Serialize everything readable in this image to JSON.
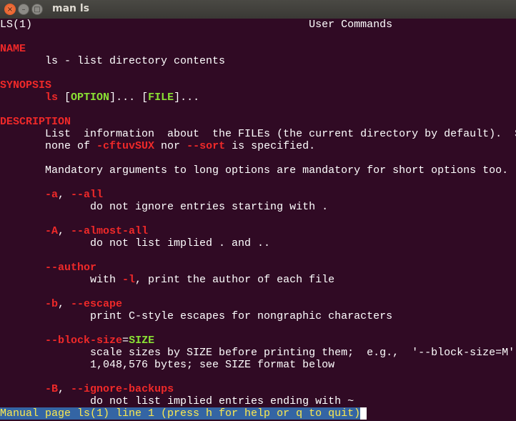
{
  "window": {
    "title": "man ls",
    "buttons": {
      "close": "×",
      "minimize": "–",
      "maximize": "□"
    }
  },
  "colors": {
    "background": "#300a24",
    "heading": "#ef2929",
    "argument": "#8ae234",
    "status_bg": "#3465a4",
    "status_fg": "#fce94f"
  },
  "lines": [
    [
      {
        "t": "LS(1)                                           User Commands",
        "c": "n"
      }
    ],
    [],
    [
      {
        "t": "NAME",
        "c": "r"
      }
    ],
    [
      {
        "t": "       ls - list directory contents",
        "c": "n"
      }
    ],
    [],
    [
      {
        "t": "SYNOPSIS",
        "c": "r"
      }
    ],
    [
      {
        "t": "       ",
        "c": "n"
      },
      {
        "t": "ls",
        "c": "r"
      },
      {
        "t": " [",
        "c": "n"
      },
      {
        "t": "OPTION",
        "c": "g"
      },
      {
        "t": "]... [",
        "c": "n"
      },
      {
        "t": "FILE",
        "c": "g"
      },
      {
        "t": "]...",
        "c": "n"
      }
    ],
    [],
    [
      {
        "t": "DESCRIPTION",
        "c": "r"
      }
    ],
    [
      {
        "t": "       List  information  about  the FILEs (the current directory by default).  Sort",
        "c": "n"
      }
    ],
    [
      {
        "t": "       none of ",
        "c": "n"
      },
      {
        "t": "-cftuvSUX",
        "c": "r"
      },
      {
        "t": " nor ",
        "c": "n"
      },
      {
        "t": "--sort",
        "c": "r"
      },
      {
        "t": " is specified.",
        "c": "n"
      }
    ],
    [],
    [
      {
        "t": "       Mandatory arguments to long options are mandatory for short options too.",
        "c": "n"
      }
    ],
    [],
    [
      {
        "t": "       ",
        "c": "n"
      },
      {
        "t": "-a",
        "c": "r"
      },
      {
        "t": ", ",
        "c": "n"
      },
      {
        "t": "--all",
        "c": "r"
      }
    ],
    [
      {
        "t": "              do not ignore entries starting with .",
        "c": "n"
      }
    ],
    [],
    [
      {
        "t": "       ",
        "c": "n"
      },
      {
        "t": "-A",
        "c": "r"
      },
      {
        "t": ", ",
        "c": "n"
      },
      {
        "t": "--almost-all",
        "c": "r"
      }
    ],
    [
      {
        "t": "              do not list implied . and ..",
        "c": "n"
      }
    ],
    [],
    [
      {
        "t": "       ",
        "c": "n"
      },
      {
        "t": "--author",
        "c": "r"
      }
    ],
    [
      {
        "t": "              with ",
        "c": "n"
      },
      {
        "t": "-l",
        "c": "r"
      },
      {
        "t": ", print the author of each file",
        "c": "n"
      }
    ],
    [],
    [
      {
        "t": "       ",
        "c": "n"
      },
      {
        "t": "-b",
        "c": "r"
      },
      {
        "t": ", ",
        "c": "n"
      },
      {
        "t": "--escape",
        "c": "r"
      }
    ],
    [
      {
        "t": "              print C-style escapes for nongraphic characters",
        "c": "n"
      }
    ],
    [],
    [
      {
        "t": "       ",
        "c": "n"
      },
      {
        "t": "--block-size",
        "c": "r"
      },
      {
        "t": "=",
        "c": "n"
      },
      {
        "t": "SIZE",
        "c": "g"
      }
    ],
    [
      {
        "t": "              scale sizes by SIZE before printing them;  e.g.,  '--block-size=M'",
        "c": "n"
      }
    ],
    [
      {
        "t": "              1,048,576 bytes; see SIZE format below",
        "c": "n"
      }
    ],
    [],
    [
      {
        "t": "       ",
        "c": "n"
      },
      {
        "t": "-B",
        "c": "r"
      },
      {
        "t": ", ",
        "c": "n"
      },
      {
        "t": "--ignore-backups",
        "c": "r"
      }
    ],
    [
      {
        "t": "              do not list implied entries ending with ~",
        "c": "n"
      }
    ]
  ],
  "status": "Manual page ls(1) line 1 (press h for help or q to quit)"
}
